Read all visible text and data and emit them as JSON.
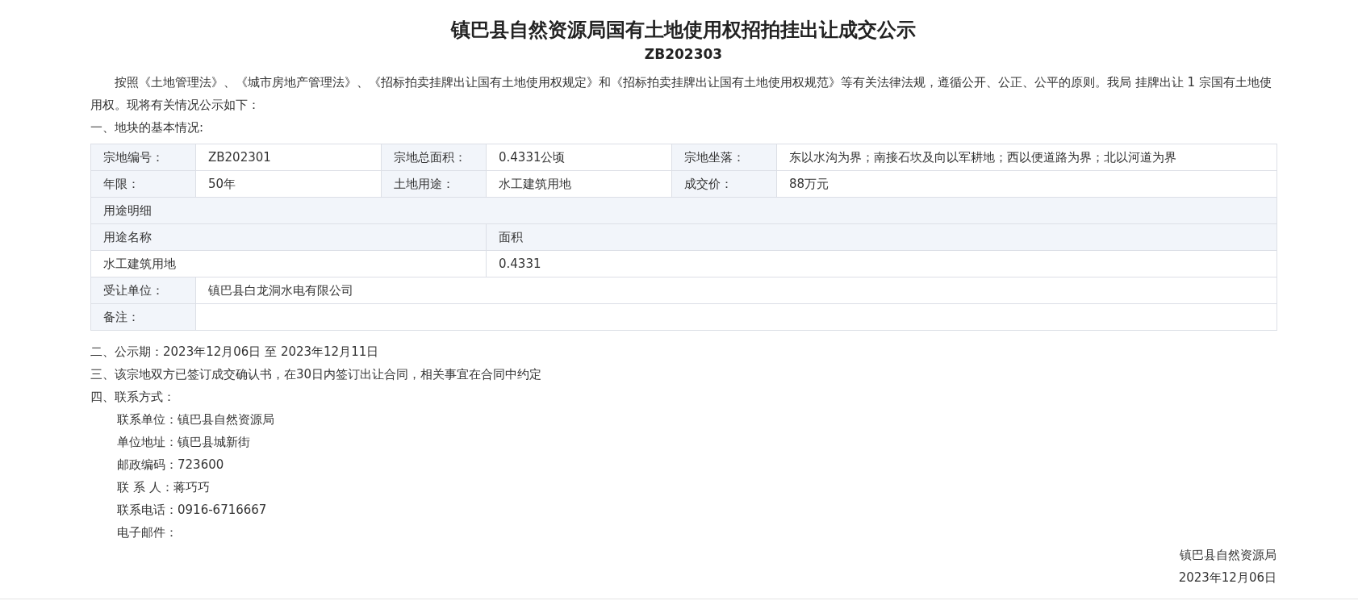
{
  "title": "镇巴县自然资源局国有土地使用权招拍挂出让成交公示",
  "number": "ZB202303",
  "intro": "按照《土地管理法》、《城市房地产管理法》、《招标拍卖挂牌出让国有土地使用权规定》和《招标拍卖挂牌出让国有土地使用权规范》等有关法律法规，遵循公开、公正、公平的原则。我局 挂牌出让 1 宗国有土地使用权。现将有关情况公示如下：",
  "basic_info": {
    "heading": "一、地块的基本情况:",
    "fields": [
      {
        "label": "宗地编号：",
        "value": "ZB202301"
      },
      {
        "label": "宗地总面积：",
        "value": "0.4331公顷"
      },
      {
        "label": "宗地坐落：",
        "value": "东以水沟为界；南接石坎及向以军耕地；西以便道路为界；北以河道为界"
      },
      {
        "label": "年限：",
        "value": "50年"
      },
      {
        "label": "土地用途：",
        "value": "水工建筑用地"
      },
      {
        "label": "成交价：",
        "value": "88万元"
      }
    ],
    "usage_detail": {
      "heading": "用途明细",
      "columns": [
        "用途名称",
        "面积"
      ],
      "rows": [
        [
          "水工建筑用地",
          "0.4331"
        ]
      ]
    },
    "transferee": {
      "label": "受让单位：",
      "value": "镇巴县白龙洞水电有限公司"
    },
    "remarks": {
      "label": "备注："
    }
  },
  "publicity_period": "二、公示期：2023年12月06日 至 2023年12月11日",
  "contract_note": "三、该宗地双方已签订成交确认书，在30日内签订出让合同，相关事宜在合同中约定",
  "contact": {
    "heading": "四、联系方式：",
    "lines": [
      "联系单位：镇巴县自然资源局",
      "单位地址：镇巴县城新街",
      "邮政编码：723600",
      "联 系 人：蒋巧巧",
      "联系电话：0916-6716667",
      "电子邮件："
    ]
  },
  "signature": {
    "issuer": "镇巴县自然资源局",
    "date": "2023年12月06日"
  }
}
